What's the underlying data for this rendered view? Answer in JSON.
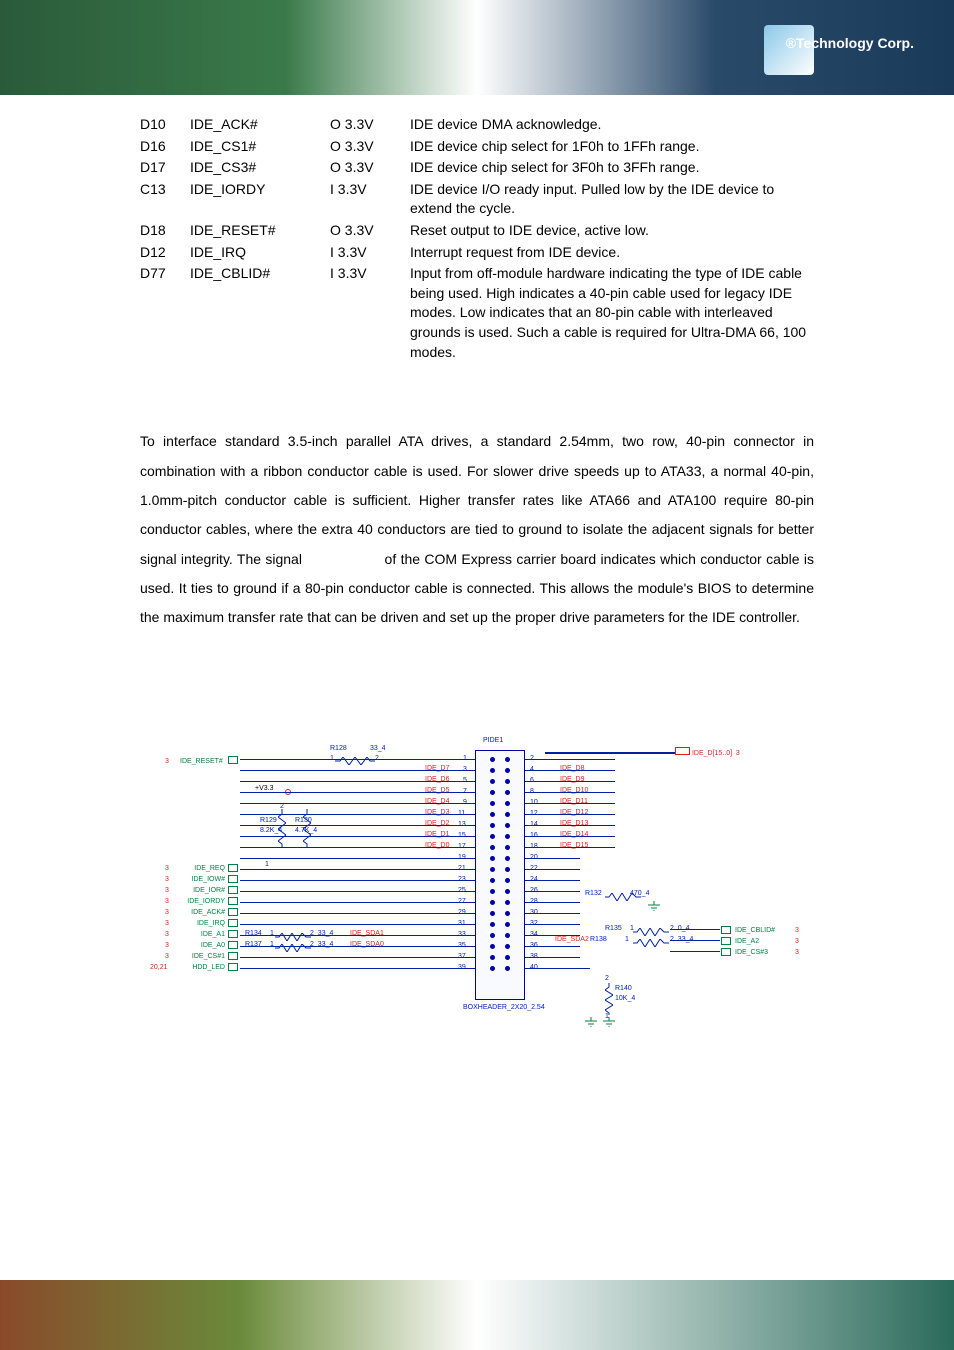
{
  "header": {
    "brand": "®Technology Corp."
  },
  "signal_table": [
    {
      "pin": "D10",
      "signal": "IDE_ACK#",
      "io": "O 3.3V",
      "desc": "IDE device DMA acknowledge."
    },
    {
      "pin": "D16",
      "signal": "IDE_CS1#",
      "io": "O 3.3V",
      "desc": "IDE device chip select for 1F0h to 1FFh range."
    },
    {
      "pin": "D17",
      "signal": "IDE_CS3#",
      "io": "O 3.3V",
      "desc": "IDE device chip select for 3F0h to 3FFh range."
    },
    {
      "pin": "C13",
      "signal": "IDE_IORDY",
      "io": "I 3.3V",
      "desc": "IDE device I/O ready input. Pulled low by the IDE device to extend the cycle."
    },
    {
      "pin": "D18",
      "signal": "IDE_RESET#",
      "io": "O 3.3V",
      "desc": "Reset output to IDE device, active low."
    },
    {
      "pin": "D12",
      "signal": "IDE_IRQ",
      "io": "I 3.3V",
      "desc": "Interrupt request from IDE device."
    },
    {
      "pin": "D77",
      "signal": "IDE_CBLID#",
      "io": "I 3.3V",
      "desc": "Input from off-module hardware indicating the type of IDE cable being used. High indicates a 40-pin cable used for legacy IDE modes. Low indicates that an 80-pin cable with interleaved grounds is used. Such a cable is required for Ultra-DMA 66, 100 modes."
    }
  ],
  "body_paragraph": "To interface standard 3.5-inch parallel ATA drives, a standard 2.54mm, two row, 40-pin connector in combination with a ribbon conductor cable is used. For slower drive speeds up to ATA33, a normal 40-pin, 1.0mm-pitch conductor cable is sufficient. Higher transfer rates like ATA66 and ATA100 require 80-pin conductor cables, where the extra 40 conductors are tied to ground to isolate the adjacent signals for better signal integrity. The signal                   of the COM Express carrier board indicates which conductor cable is used. It ties to ground if a 80-pin conductor cable is connected. This allows the module's BIOS to determine the maximum transfer rate that can be driven and set up the proper drive parameters for the IDE controller.",
  "diagram": {
    "connector_ref": "PIDE1",
    "connector_type": "BOXHEADER_2X20_2.54",
    "bus_label": "IDE_D[15..0]",
    "bus_page": "3",
    "power_label": "+V3.3",
    "left_page_prefix": "3",
    "hdd_led_page": "20,21",
    "resistors": {
      "R128": {
        "val": "33_4",
        "pins": [
          "1",
          "2"
        ]
      },
      "R129": {
        "val": "8.2K_4",
        "pins": [
          "1",
          "2"
        ]
      },
      "R130": {
        "val": "4.7K_4",
        "pins": [
          "1",
          "2"
        ]
      },
      "R132": {
        "val": "470_4"
      },
      "R134": {
        "val": "33_4",
        "pins": [
          "1",
          "2"
        ]
      },
      "R135": {
        "val": "0_4",
        "pins": [
          "1",
          "2"
        ]
      },
      "R137": {
        "val": "33_4",
        "pins": [
          "1",
          "2"
        ]
      },
      "R138": {
        "val": "33_4",
        "pins": [
          "1",
          "2"
        ]
      },
      "R140": {
        "val": "10K_4",
        "pins": [
          "1",
          "2"
        ]
      }
    },
    "left_nets": [
      "IDE_D7",
      "IDE_D6",
      "IDE_D5",
      "IDE_D4",
      "IDE_D3",
      "IDE_D2",
      "IDE_D1",
      "IDE_D0"
    ],
    "right_nets": [
      "IDE_D8",
      "IDE_D9",
      "IDE_D10",
      "IDE_D11",
      "IDE_D12",
      "IDE_D13",
      "IDE_D14",
      "IDE_D15"
    ],
    "left_ports": [
      "IDE_RESET#",
      "IDE_REQ",
      "IDE_IOW#",
      "IDE_IOR#",
      "IDE_IORDY",
      "IDE_ACK#",
      "IDE_IRQ",
      "IDE_A1",
      "IDE_A0",
      "IDE_CS#1",
      "HDD_LED"
    ],
    "sda_labels": [
      "IDE_SDA1",
      "IDE_SDA0"
    ],
    "right_sda": [
      "IDE_SDA2"
    ],
    "right_ports": [
      "IDE_CBLID#",
      "IDE_A2",
      "IDE_CS#3"
    ],
    "right_port_pages": [
      "3",
      "3",
      "3"
    ],
    "pin_numbers_left": [
      "1",
      "3",
      "5",
      "7",
      "9",
      "11",
      "13",
      "15",
      "17",
      "19",
      "21",
      "23",
      "25",
      "27",
      "29",
      "31",
      "33",
      "35",
      "37",
      "39"
    ],
    "pin_numbers_right": [
      "2",
      "4",
      "6",
      "8",
      "10",
      "12",
      "14",
      "16",
      "18",
      "20",
      "22",
      "24",
      "26",
      "28",
      "30",
      "32",
      "34",
      "36",
      "38",
      "40"
    ]
  }
}
